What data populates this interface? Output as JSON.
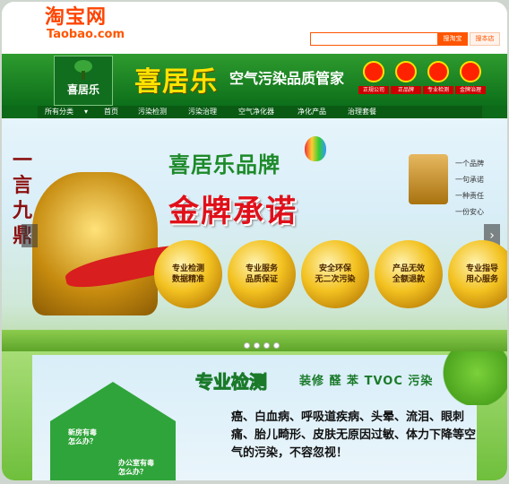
{
  "taobao": {
    "logo_cn": "淘宝网",
    "logo_en": "Taobao.com",
    "search_placeholder": "",
    "search_all_label": "搜淘宝",
    "search_store_label": "搜本店"
  },
  "store": {
    "logo_text": "喜居乐",
    "brand_name": "喜居乐",
    "slogan": "空气污染品质管家",
    "badges": [
      "正规公司",
      "正品牌",
      "专业检测",
      "金牌治理"
    ]
  },
  "nav": {
    "all_categories": "所有分类",
    "items": [
      "首页",
      "污染检测",
      "污染治理",
      "空气净化器",
      "净化产品",
      "治理套餐"
    ]
  },
  "banner1": {
    "title": "喜居乐品牌",
    "big_slogan": "金牌承诺",
    "pillar_text": "一言九鼎",
    "promises": [
      "一个品牌",
      "一句承诺",
      "一种责任",
      "一份安心"
    ],
    "medals": [
      "专业检测\n数据精准",
      "专业服务\n品质保证",
      "安全环保\n无二次污染",
      "产品无效\n全额退款",
      "专业指导\n用心服务"
    ],
    "prev_arrow": "‹",
    "next_arrow": "›"
  },
  "banner2": {
    "title": "专业检测",
    "subtitle": "装修 醛 苯 TVOC 污染",
    "house_labels": [
      "新房有毒\n怎么办？",
      "办公室有毒\n怎么办？"
    ],
    "text": "癌、白血病、呼吸道疾病、头晕、流泪、眼刺痛、胎儿畸形、皮肤无原因过敏、体力下降等空气的污染，不容忽视！"
  },
  "colors": {
    "taobao_orange": "#ff5500",
    "store_green": "#0d6f1a",
    "brand_yellow": "#ffe300",
    "promise_red": "#e0101a"
  }
}
